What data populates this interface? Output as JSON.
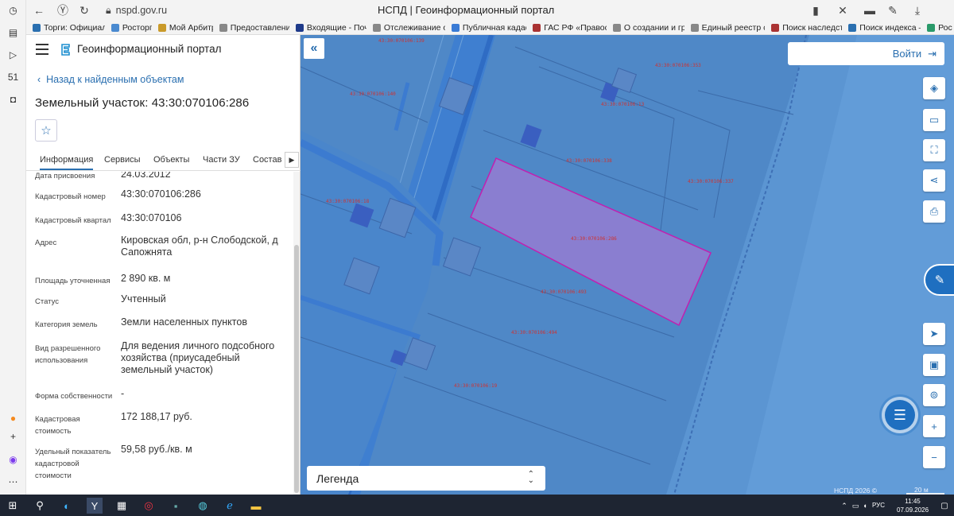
{
  "browser": {
    "url": "nspd.gov.ru",
    "tab_title": "НСПД | Геоинформационный портал",
    "bookmarks": [
      {
        "label": "Торги: Официаль",
        "color": "#2a6fb0"
      },
      {
        "label": "Росторг",
        "color": "#4a8ad0"
      },
      {
        "label": "Мой Арбитр",
        "color": "#c99a2a"
      },
      {
        "label": "Предоставление",
        "color": "#888888"
      },
      {
        "label": "Входящие - Почт",
        "color": "#1e3a8a"
      },
      {
        "label": "Отслеживание от",
        "color": "#888888"
      },
      {
        "label": "Публичная кадаст",
        "color": "#3a7bd5"
      },
      {
        "label": "ГАС РФ «Правосу",
        "color": "#a33"
      },
      {
        "label": "О создании и гра",
        "color": "#888888"
      },
      {
        "label": "Единый реестр су",
        "color": "#888888"
      },
      {
        "label": "Поиск наследсте",
        "color": "#a33"
      },
      {
        "label": "Поиск индекса —",
        "color": "#2a6fb0"
      },
      {
        "label": "Рос",
        "color": "#2a9a6a"
      }
    ]
  },
  "panel": {
    "portal_name": "Геоинформационный портал",
    "back_label": "Назад к найденным объектам",
    "title": "Земельный участок: 43:30:070106:286",
    "tabs": [
      "Информация",
      "Сервисы",
      "Объекты",
      "Части ЗУ",
      "Состав"
    ],
    "properties": [
      {
        "label": "Дата присвоения",
        "value": "24.03.2012"
      },
      {
        "label": "Кадастровый номер",
        "value": "43:30:070106:286"
      },
      {
        "label": "Кадастровый квартал",
        "value": "43:30:070106"
      },
      {
        "label": "Адрес",
        "value": "Кировская обл, р-н Слободской, д Сапожнята"
      },
      {
        "label": "Площадь уточненная",
        "value": "2 890 кв. м"
      },
      {
        "label": "Статус",
        "value": "Учтенный"
      },
      {
        "label": "Категория земель",
        "value": "Земли населенных пунктов"
      },
      {
        "label": "Вид разрешенного использования",
        "value": "Для ведения личного подсобного хозяйства (приусадебный земельный участок)"
      },
      {
        "label": "Форма собственности",
        "value": "-"
      },
      {
        "label": "Кадастровая стоимость",
        "value": "172 188,17 руб."
      },
      {
        "label": "Удельный показатель кадастровой стоимости",
        "value": "59,58 руб./кв. м"
      }
    ]
  },
  "map": {
    "login_label": "Войти",
    "legend_label": "Легенда",
    "copyright": "НСПД 2026 ©",
    "scale_label": "20 м",
    "parcel_labels": [
      "43:30:070106:139",
      "43:30:070106:353",
      "43:30:070106:140",
      "43:30:070106:13",
      "43:30:070106:338",
      "43:30:070106:337",
      "43:30:070106:18",
      "43:30:070106:286",
      "43:30:070106:493",
      "43:30:070106:494",
      "43:30:070106:19"
    ],
    "colors": {
      "map_bg": "#4f88c7",
      "selected_fill": "#8a7ed0",
      "selected_stroke": "#c21fb0"
    }
  },
  "taskbar": {
    "lang": "РУС",
    "time": "11:45",
    "date": "07.09.2026"
  }
}
